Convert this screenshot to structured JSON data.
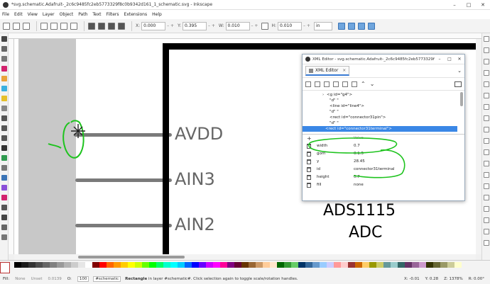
{
  "window": {
    "title": "*svg.schematic.Adafruit-_2c6c9485fc2eb5773329f8c0b9342d161_1_schematic.svg - Inkscape",
    "minimize_icon": "minimize-icon",
    "maximize_icon": "maximize-icon",
    "close_icon": "close-icon"
  },
  "menu": [
    "File",
    "Edit",
    "View",
    "Layer",
    "Object",
    "Path",
    "Text",
    "Filters",
    "Extensions",
    "Help"
  ],
  "toolbar": {
    "x_label": "X:",
    "x_value": "0.000",
    "y_label": "Y:",
    "y_value": "0.395",
    "w_label": "W:",
    "w_value": "0.010",
    "h_label": "H:",
    "h_value": "0.010",
    "unit": "in",
    "spin": "–  +"
  },
  "canvas": {
    "pins": [
      "AVDD",
      "AIN3",
      "AIN2"
    ],
    "chip_name": "ADS1115",
    "chip_sub": "ADC",
    "annotation_color": "#1ec31e"
  },
  "xml_editor": {
    "title": "XML Editor - svg.schematic.Adafruit-_2c6c9485fc2eb5773329f8c0b9342d161_1_schematic.svg",
    "tab_label": "XML Editor",
    "tab_close": "×",
    "nodes": [
      {
        "text": "<g id=\"g4\">",
        "indent": 0,
        "expander": "›"
      },
      {
        "text": "\"d\"     \"",
        "indent": 1,
        "expander": ""
      },
      {
        "text": "<line id=\"line4\">",
        "indent": 1,
        "expander": ""
      },
      {
        "text": "\"d\"     \"",
        "indent": 1,
        "expander": ""
      },
      {
        "text": "<rect id=\"connector31pin\">",
        "indent": 1,
        "expander": ""
      },
      {
        "text": "\"d\"     \"",
        "indent": 1,
        "expander": ""
      },
      {
        "text": "<rect id=\"connector31terminal\">",
        "indent": 1,
        "expander": "",
        "selected": true
      }
    ],
    "attr_header_value": "Value",
    "attr_add": "+",
    "attributes": [
      {
        "name": "width",
        "value": "0.7"
      },
      {
        "name": "gorn",
        "value": "0.1.5"
      },
      {
        "name": "y",
        "value": "28.45"
      },
      {
        "name": "id",
        "value": "connector31terminal"
      },
      {
        "name": "height",
        "value": "0.7"
      },
      {
        "name": "fill",
        "value": "none"
      }
    ]
  },
  "status": {
    "fill_label": "Fill:",
    "fill_value": "None",
    "stroke_label": "Unset",
    "stroke_width": "0.0139",
    "opacity_label": "O:",
    "opacity_value": "100",
    "layer": "#schematic",
    "message_bold": "Rectangle",
    "message": " in layer #schematic#. Click selection again to toggle scale/rotation handles.",
    "x_label": "X:",
    "x_value": "-0.01",
    "y_label": "Y:",
    "y_value": "0.28",
    "zoom_label": "Z:",
    "zoom_value": "1378%",
    "rotate_label": "R:",
    "rotate_value": "0.00°"
  },
  "palette_colors": [
    "#000000",
    "#1a1a1a",
    "#333333",
    "#4d4d4d",
    "#666666",
    "#808080",
    "#999999",
    "#b3b3b3",
    "#cccccc",
    "#e6e6e6",
    "#ffffff",
    "#800000",
    "#ff0000",
    "#ff6600",
    "#ff9900",
    "#ffcc00",
    "#ffff00",
    "#ccff00",
    "#66ff00",
    "#00ff00",
    "#00ff66",
    "#00ffcc",
    "#00ffff",
    "#00ccff",
    "#0066ff",
    "#0000ff",
    "#6600ff",
    "#cc00ff",
    "#ff00ff",
    "#ff0099",
    "#800080",
    "#660033",
    "#663300",
    "#996633",
    "#cc9966",
    "#ffcc99",
    "#ffe6cc",
    "#006600",
    "#339933",
    "#66cc66",
    "#003366",
    "#336699",
    "#6699cc",
    "#99ccff",
    "#ccccff",
    "#ff9999",
    "#ffcccc",
    "#993333",
    "#cc6600",
    "#ffcc66",
    "#999900",
    "#cccc66",
    "#669999",
    "#99cccc",
    "#336666",
    "#663366",
    "#996699",
    "#cc99cc",
    "#333300",
    "#666633",
    "#999966",
    "#cccc99",
    "#ffffcc"
  ]
}
